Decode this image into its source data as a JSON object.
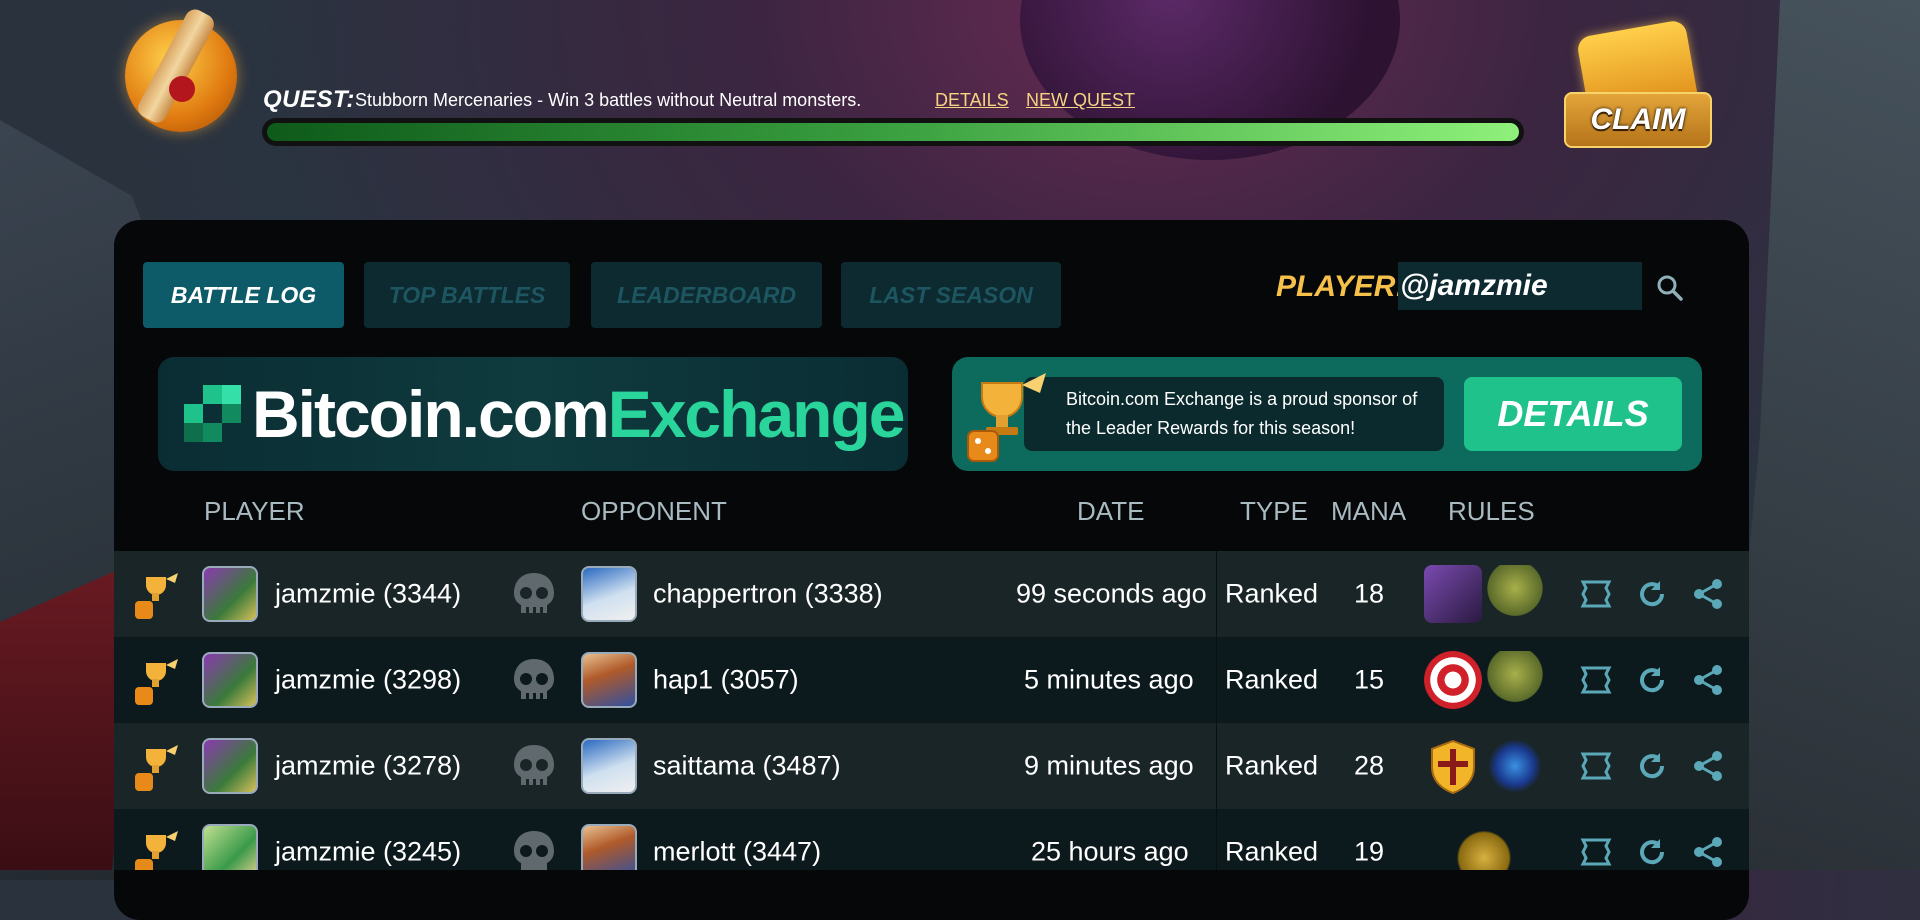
{
  "quest": {
    "label": "QUEST:",
    "text": "Stubborn Mercenaries - Win 3 battles without Neutral monsters.",
    "details_link": "DETAILS",
    "new_quest_link": "NEW QUEST",
    "progress_fraction": 1.0,
    "claim_label": "CLAIM"
  },
  "tabs": [
    {
      "label": "BATTLE LOG",
      "active": true
    },
    {
      "label": "TOP BATTLES",
      "active": false
    },
    {
      "label": "LEADERBOARD",
      "active": false
    },
    {
      "label": "LAST SEASON",
      "active": false
    }
  ],
  "player_search": {
    "label": "PLAYER:",
    "value": "@jamzmie"
  },
  "sponsor": {
    "logo_part1": "Bitcoin.com",
    "logo_part2": "Exchange",
    "message": "Bitcoin.com Exchange is a proud sponsor of the Leader Rewards for this season!",
    "details_label": "DETAILS"
  },
  "table": {
    "headers": {
      "player": "PLAYER",
      "opponent": "OPPONENT",
      "date": "DATE",
      "type": "TYPE",
      "mana": "MANA",
      "rules": "RULES"
    },
    "rows": [
      {
        "player": "jamzmie (3344)",
        "opponent": "chappertron (3338)",
        "date": "99 seconds ago",
        "type": "Ranked",
        "mana": "18",
        "rules": [
          "hooded-rule-icon",
          "goblin-rule-icon"
        ]
      },
      {
        "player": "jamzmie (3298)",
        "opponent": "hap1 (3057)",
        "date": "5 minutes ago",
        "type": "Ranked",
        "mana": "15",
        "rules": [
          "target-rule-icon",
          "goblin-rule-icon"
        ]
      },
      {
        "player": "jamzmie (3278)",
        "opponent": "saittama (3487)",
        "date": "9 minutes ago",
        "type": "Ranked",
        "mana": "28",
        "rules": [
          "shield-rule-icon",
          "vortex-rule-icon"
        ]
      },
      {
        "player": "jamzmie (3245)",
        "opponent": "merlott (3447)",
        "date": "25 hours ago",
        "type": "Ranked",
        "mana": "19",
        "rules": [
          "gong-rule-icon"
        ]
      }
    ]
  },
  "colors": {
    "accent_teal": "#0d5a68",
    "sponsor_green": "#1fc28a",
    "player_label": "#f6c04a",
    "quest_link": "#f5d480"
  }
}
